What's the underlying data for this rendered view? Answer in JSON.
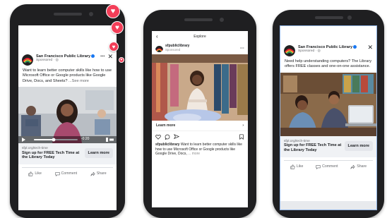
{
  "fb_ad_video": {
    "page_name": "San Francisco Public Library",
    "sponsored": "Sponsored · ",
    "more_icon": "more-dots-icon",
    "close_icon": "close-icon",
    "text": "Want to learn better computer skills like how to use Microsoft Office or Google products like Google Drive, Docs, and Sheets?",
    "see_more": "...See more",
    "video_time": "-0:20",
    "video_progress": 0.45,
    "cta_url": "sfpl.org/tech-time",
    "cta_title": "Sign up for FREE Tech Time at the Library Today",
    "cta_button": "Learn more",
    "like": "Like",
    "comment": "Comment",
    "share": "Share"
  },
  "instagram_ad": {
    "header": "Explore",
    "back_icon": "back-arrow-icon",
    "username": "sfpubliclibrary",
    "sponsored": "Sponsored",
    "learn_more": "Learn more",
    "caption_user": "sfpubliclibrary",
    "caption": "Want to learn better computer skills like how to use Microsoft Office or Google products like Google Drive, Docs,",
    "caption_more": "... more"
  },
  "fb_ad_image": {
    "page_name": "San Francisco Public Library",
    "sponsored": "Sponsored · ",
    "text": "Need help understanding computers? The Library offers FREE classes and one-on-one assistance.",
    "cta_url": "sfpl.org/tech-time",
    "cta_title": "Sign up for FREE Tech Time at the Library Today",
    "cta_button": "Learn more",
    "like": "Like",
    "comment": "Comment",
    "share": "Share"
  },
  "colors": {
    "facebook_blue": "#1877f2",
    "reaction_red": "#f33e58",
    "phone_body": "#1f1f21"
  }
}
